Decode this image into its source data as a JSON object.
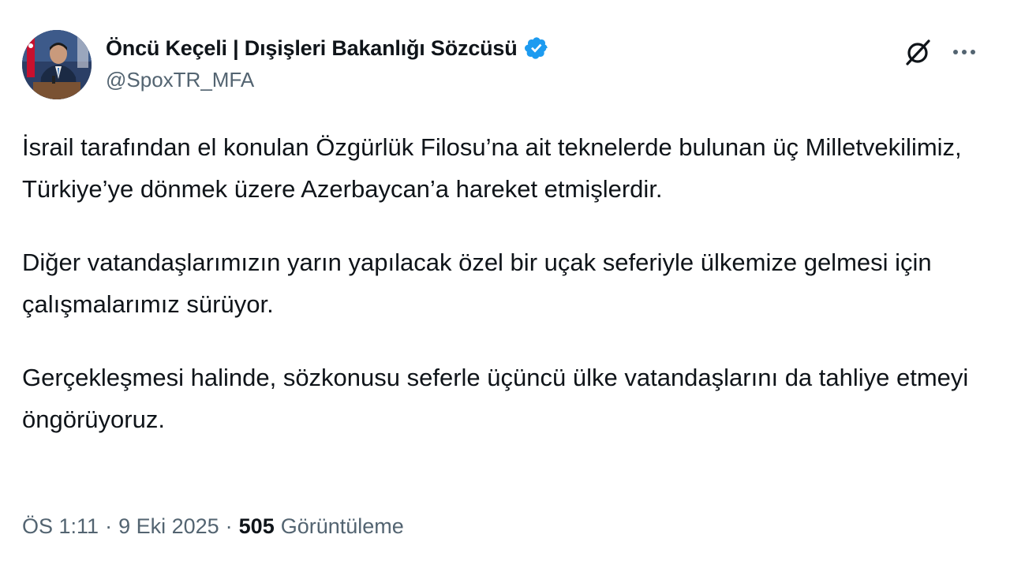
{
  "author": {
    "display_name": "Öncü Keçeli | Dışişleri Bakanlığı Sözcüsü",
    "handle": "@SpoxTR_MFA",
    "verified": true,
    "verified_color": "#1d9bf0"
  },
  "actions": {
    "grok_icon": "grok-icon",
    "more_icon": "more-icon"
  },
  "tweet": {
    "paragraphs": [
      "İsrail tarafından el konulan Özgürlük Filosu’na ait teknelerde bulunan üç Milletvekilimiz, Türkiye’ye dönmek üzere Azerbaycan’a hareket etmişlerdir.",
      "Diğer vatandaşlarımızın yarın yapılacak özel bir uçak seferiyle ülkemize gelmesi için çalışmalarımız sürüyor.",
      "Gerçekleşmesi halinde, sözkonusu seferle üçüncü ülke vatandaşlarını da tahliye etmeyi öngörüyoruz."
    ]
  },
  "meta": {
    "time": "ÖS 1:11",
    "separator": "·",
    "date": "9 Eki 2025",
    "views_count": "505",
    "views_label": "Görüntüleme"
  },
  "colors": {
    "text_primary": "#0f1419",
    "text_secondary": "#536471"
  }
}
